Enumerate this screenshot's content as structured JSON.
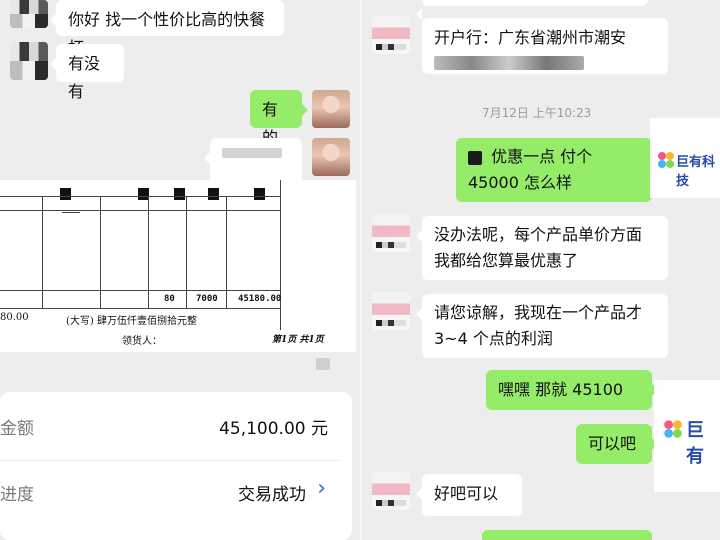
{
  "left": {
    "messages": [
      {
        "text": "你好  找一个性价比高的快餐杯"
      },
      {
        "text": "有没有"
      },
      {
        "text": "有的"
      }
    ],
    "document": {
      "row_values": [
        "80",
        "7000",
        "45180.00"
      ],
      "amount_fragment": "80.00",
      "amount_caps": "(大写)  肆万伍仟壹佰捌拾元整",
      "receiver_label": "领货人：",
      "page_info": "第1页  共1页"
    },
    "card": {
      "amount_label": "金额",
      "amount_value": "45,100.00 元",
      "progress_label": "进度",
      "progress_value": "交易成功",
      "chevron": "›"
    }
  },
  "right": {
    "messages": [
      {
        "text": "开户行：广东省潮州市潮安"
      },
      {
        "text": "优惠一点   付个 45000 怎么样"
      },
      {
        "text": "没办法呢，每个产品单价方面我都给您算最优惠了"
      },
      {
        "text": "请您谅解，我现在一个产品才 3~4 个点的利润"
      },
      {
        "text": "嘿嘿  那就 45100"
      },
      {
        "text": "可以吧"
      },
      {
        "text": "好吧可以"
      }
    ],
    "timestamp": "7月12日 上午10:23",
    "watermark": "巨有科技",
    "watermark_sub": "巨有",
    "colors": {
      "bubble_out": "#95ec69",
      "bubble_in": "#ffffff",
      "background": "#ededed"
    }
  }
}
